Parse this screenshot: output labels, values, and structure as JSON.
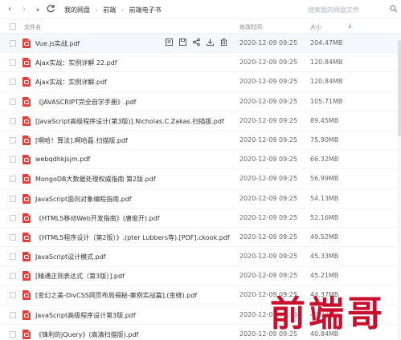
{
  "toolbar": {
    "back_label": "‹",
    "forward_label": "›",
    "dropdown_label": "▾",
    "breadcrumb": [
      "我的网盘",
      "前端",
      "前端电子书"
    ],
    "search_placeholder": "搜索我的网盘文件"
  },
  "columns": {
    "name": "文件名",
    "time": "修改时间",
    "size": "大小",
    "sort_indicator": "↓"
  },
  "files": [
    {
      "name": "Vue.js实战.pdf",
      "time": "2020-12-09 09:25",
      "size": "204.47MB"
    },
    {
      "name": "Ajax实战：实例详解 22.pdf",
      "time": "2020-12-09 09:25",
      "size": "120.84MB"
    },
    {
      "name": "Ajax实战：实例详解.pdf",
      "time": "2020-12-09 09:25",
      "size": "120.84MB"
    },
    {
      "name": "《JAVASCRIPT完全自学手册》.pdf",
      "time": "2020-12-09 09:25",
      "size": "105.71MB"
    },
    {
      "name": "[JavaScript高级程序设计(第3版)].Nicholas.C.Zakas.扫描版.pdf",
      "time": "2020-12-09 09:25",
      "size": "89.45MB"
    },
    {
      "name": "[啊哈！算法].啊哈磊.扫描版.pdf",
      "time": "2020-12-09 09:25",
      "size": "75.90MB"
    },
    {
      "name": "webqdhkjsjm.pdf",
      "time": "2020-12-09 09:25",
      "size": "66.32MB"
    },
    {
      "name": "MongoDB大数据处理权威指南 第2版.pdf",
      "time": "2020-12-09 09:25",
      "size": "56.99MB"
    },
    {
      "name": "JavaScript面向对象编程指南.pdf",
      "time": "2020-12-09 09:25",
      "size": "54.13MB"
    },
    {
      "name": "《HTML5移动Web开发指南》(唐俊开).pdf",
      "time": "2020-12-09 09:25",
      "size": "52.16MB"
    },
    {
      "name": "《HTML5程序设计（第2版）》.(pter Lubbers等).[PDF].ckook.pdf",
      "time": "2020-12-09 09:25",
      "size": "49.52MB"
    },
    {
      "name": "JavaScript设计模式.pdf",
      "time": "2020-12-09 09:25",
      "size": "45.33MB"
    },
    {
      "name": "[精通正则表达式（第3版）].pdf",
      "time": "2020-12-09 09:25",
      "size": "45.21MB"
    },
    {
      "name": "[变幻之美-DivCSS网页布局揭秘-案例实战篇].(金缝).pdf",
      "time": "2020-12-09 09:25",
      "size": "44.37MB"
    },
    {
      "name": "JavaScript高级程序设计第3版.pdf",
      "time": "2020-12-09 09:25",
      "size": "43.23MB"
    },
    {
      "name": "《锋利的jQuery》(高清扫描版).pdf",
      "time": "2020-12-09 09:25",
      "size": "40.84MB"
    }
  ],
  "row_actions": [
    "open-icon",
    "save-icon",
    "share-icon",
    "download-icon",
    "delete-icon"
  ],
  "watermark": {
    "text": "前端哥",
    "color": "#c8102e"
  },
  "colors": {
    "pdf_red": "#e0413c",
    "accent_blue": "#2d8cf0",
    "hover_row": "#f4f8fd"
  }
}
